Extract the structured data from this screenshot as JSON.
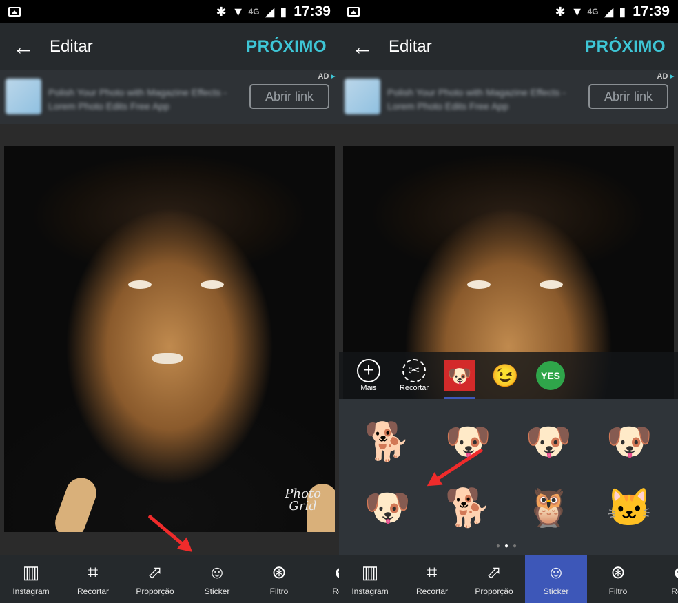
{
  "status": {
    "time": "17:39",
    "network": "4G"
  },
  "appbar": {
    "title": "Editar",
    "next": "PRÓXIMO"
  },
  "ad": {
    "tag": "AD",
    "open_link": "Abrir link",
    "text": "Polish Your Photo with Magazine Effects - Lorem Photo Edits Free App"
  },
  "watermark": {
    "line1": "Photo",
    "line2": "Grid"
  },
  "tools": [
    {
      "label": "Instagram",
      "icon": "instagram-frame-icon"
    },
    {
      "label": "Recortar",
      "icon": "crop-icon"
    },
    {
      "label": "Proporção",
      "icon": "aspect-ratio-icon"
    },
    {
      "label": "Sticker",
      "icon": "sticker-icon"
    },
    {
      "label": "Filtro",
      "icon": "filter-icon"
    },
    {
      "label": "Reto",
      "icon": "retouch-face-icon"
    }
  ],
  "sticker_tabs": [
    {
      "label": "Mais",
      "icon": "add-circle-icon"
    },
    {
      "label": "Recortar",
      "icon": "scissors-icon"
    },
    {
      "label": "",
      "icon": "dog-pack-icon"
    },
    {
      "label": "",
      "icon": "emoji-pack-icon"
    },
    {
      "label": "",
      "icon": "yes-badge-icon"
    }
  ],
  "stickers": [
    "golden-puppy-sticker-icon",
    "boxer-puppy-sticker-icon",
    "pug-face-sticker-icon",
    "pug-tongue-sticker-icon",
    "boxer-dog-sticker-icon",
    "terrier-dog-sticker-icon",
    "owl-sticker-icon",
    "calico-cat-sticker-icon"
  ],
  "colors": {
    "accent": "#3ec5d5",
    "active_tab": "#3d57b8",
    "arrow": "#ef2b2b"
  },
  "pager": {
    "count": 3,
    "current": 2
  }
}
